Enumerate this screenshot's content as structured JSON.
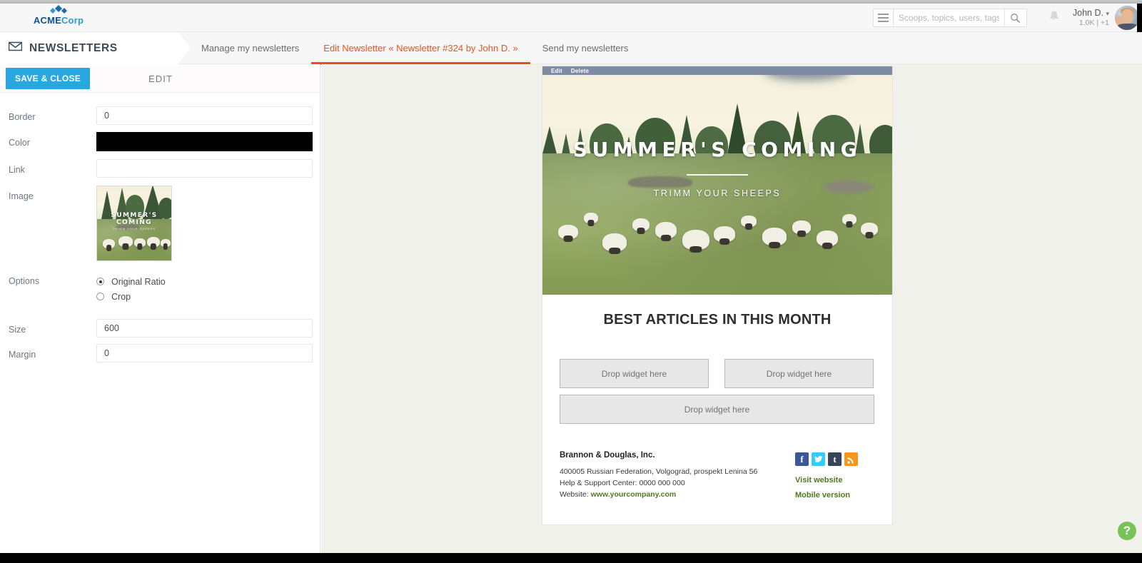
{
  "brand": {
    "name_part1": "ACME",
    "name_part2": "Corp",
    "logo_icon": "diamond-cluster-icon"
  },
  "header": {
    "menu_icon": "hamburger-icon",
    "search": {
      "placeholder": "Scoops, topics, users, tags",
      "value": "",
      "icon": "search-icon"
    },
    "notifications_icon": "bell-icon",
    "user": {
      "name": "John D.",
      "caret": "▾",
      "stats": "1.0K | +1",
      "avatar": "user-avatar"
    }
  },
  "section": {
    "icon": "envelope-icon",
    "title": "NEWSLETTERS",
    "tabs": [
      {
        "label": "Manage my newsletters",
        "active": false
      },
      {
        "label": "Edit Newsletter « Newsletter #324 by John D. »",
        "active": true
      },
      {
        "label": "Send my newsletters",
        "active": false
      }
    ],
    "active_tab_color": "#f04b16"
  },
  "editor": {
    "save_close_label": "SAVE & CLOSE",
    "panel_title": "EDIT",
    "fields": {
      "border": {
        "label": "Border",
        "value": "0",
        "placeholder": ""
      },
      "color": {
        "label": "Color",
        "value": "#000000"
      },
      "link": {
        "label": "Link",
        "value": "",
        "placeholder": ""
      },
      "image": {
        "label": "Image",
        "thumbnail_alt": "SUMMER'S COMING sheep photo"
      },
      "options": {
        "label": "Options",
        "choices": [
          {
            "label": "Original Ratio",
            "selected": true
          },
          {
            "label": "Crop",
            "selected": false
          }
        ]
      },
      "size": {
        "label": "Size",
        "value": "600",
        "placeholder": ""
      },
      "margin": {
        "label": "Margin",
        "value": "0",
        "placeholder": ""
      }
    }
  },
  "newsletter": {
    "block_toolbar": {
      "edit": "Edit",
      "delete": "Delete"
    },
    "hero": {
      "title": "SUMMER'S COMING",
      "subtitle": "TRIMM YOUR SHEEPS"
    },
    "heading": "BEST ARTICLES IN THIS MONTH",
    "dropzones": [
      {
        "label": "Drop widget here"
      },
      {
        "label": "Drop widget here"
      },
      {
        "label": "Drop widget here"
      }
    ],
    "footer": {
      "company": "Brannon & Douglas, Inc.",
      "address": "400005 Russian Federation, Volgograd, prospekt Lenina 56",
      "support": "Help & Support Center: 0000 000 000",
      "website_prefix": "Website:",
      "website": "www.yourcompany.com",
      "socials": [
        {
          "name": "facebook",
          "glyph": "f",
          "color": "#3b5998"
        },
        {
          "name": "twitter",
          "glyph": "ᴠ",
          "color": "#32ccfe"
        },
        {
          "name": "tumblr",
          "glyph": "t",
          "color": "#35465c"
        },
        {
          "name": "rss",
          "glyph": "◔",
          "color": "#f8951d"
        }
      ],
      "links": [
        {
          "label": "Visit website"
        },
        {
          "label": "Mobile version"
        }
      ],
      "link_color": "#4d7a1e"
    }
  },
  "help": {
    "label": "?",
    "color": "#78c257"
  }
}
